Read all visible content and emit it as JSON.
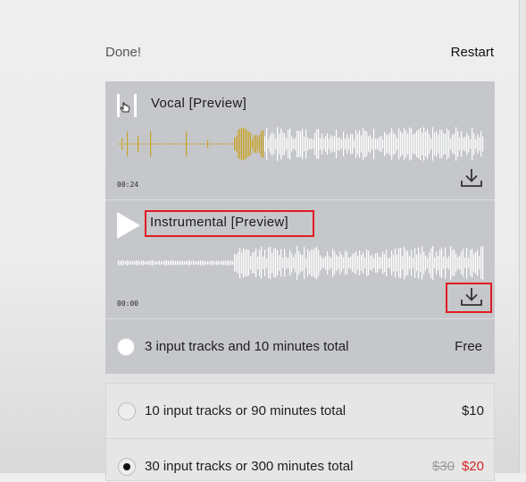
{
  "header": {
    "status": "Done!",
    "restart_label": "Restart"
  },
  "tracks": [
    {
      "title": "Vocal [Preview]",
      "time": "00:24",
      "state": "playing"
    },
    {
      "title": "Instrumental [Preview]",
      "time": "00:00",
      "state": "paused"
    }
  ],
  "plans": [
    {
      "label": "3 input tracks and 10 minutes total",
      "price": "Free",
      "old_price": "",
      "selected": false
    },
    {
      "label": "10 input tracks or 90 minutes total",
      "price": "$10",
      "old_price": "",
      "selected": false
    },
    {
      "label": "30 input tracks or 300 minutes total",
      "price": "$20",
      "old_price": "$30",
      "selected": true
    }
  ],
  "colors": {
    "played_wave": "#c9a227",
    "unplayed_wave": "#ffffff",
    "highlight": "#e11b22",
    "sale_price": "#d62728"
  }
}
